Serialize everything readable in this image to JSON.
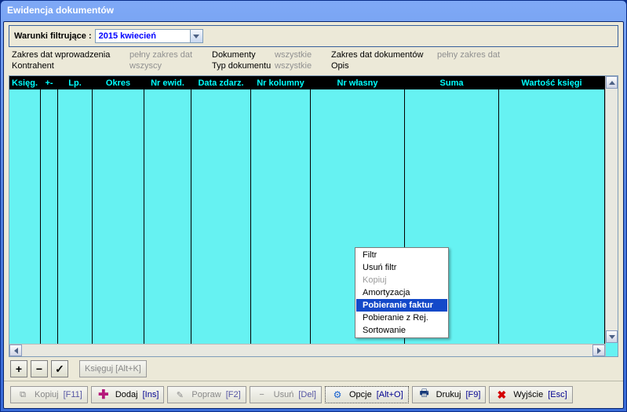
{
  "title": "Ewidencja dokumentów",
  "filterLabel": "Warunki filtrujące :",
  "period": "2015 kwiecień",
  "filters": {
    "r1": {
      "a_lbl": "Zakres dat wprowadzenia",
      "a_val": "pełny zakres dat",
      "b_lbl": "Dokumenty",
      "b_val": "wszystkie",
      "c_lbl": "Zakres dat dokumentów",
      "c_val": "pełny zakres dat"
    },
    "r2": {
      "a_lbl": "Kontrahent",
      "a_val": "wszyscy",
      "b_lbl": "Typ dokumentu",
      "b_val": "wszystkie",
      "c_lbl": "Opis",
      "c_val": ""
    }
  },
  "columns": [
    "Księg.",
    "+-",
    "Lp.",
    "Okres",
    "Nr ewid.",
    "Data zdarz.",
    "Nr kolumny",
    "Nr własny",
    "Suma",
    "Wartość księgi"
  ],
  "menu": {
    "filtr": "Filtr",
    "usun": "Usuń filtr",
    "kopiuj": "Kopiuj",
    "amort": "Amortyzacja",
    "pobf": "Pobieranie faktur",
    "pobr": "Pobieranie z Rej.",
    "sort": "Sortowanie"
  },
  "rowbar": {
    "ksieguj": "Księguj [Alt+K]"
  },
  "footer": {
    "kopiuj": "Kopiuj",
    "kopiuj_k": "[F11]",
    "dodaj": "Dodaj",
    "dodaj_k": "[Ins]",
    "popraw": "Popraw",
    "popraw_k": "[F2]",
    "usun": "Usuń",
    "usun_k": "[Del]",
    "opcje": "Opcje",
    "opcje_k": "[Alt+O]",
    "drukuj": "Drukuj",
    "drukuj_k": "[F9]",
    "wyjscie": "Wyjście",
    "wyjscie_k": "[Esc]"
  }
}
